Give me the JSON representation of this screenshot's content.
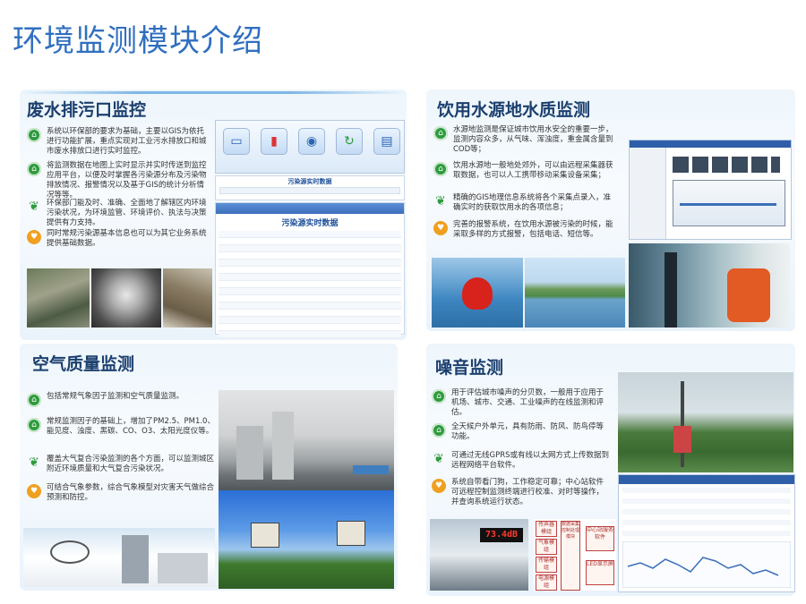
{
  "page": {
    "title": "环境监测模块介绍"
  },
  "panels": {
    "wastewater": {
      "title": "废水排污口监控",
      "bullets": [
        "系统以环保部的要求为基础，主要以GIS为依托进行功能扩展，重点实现对工业污水排放口和城市废水排放口进行实时监控。",
        "将监测数据在地图上实时显示并实时传送到监控应用平台，以便及时掌握各污染源分布及污染物排放情况、报警情况以及基于GIS的统计分析情况等等。",
        "环保部门能及时、准确、全面地了解辖区内环境污染状况，为环境监管、环境评价、执法与决策提供有力支持。",
        "同时常规污染源基本信息也可以为其它业务系统提供基础数据。"
      ],
      "table_title": "污染源实时数据",
      "search_title": "污染源实时数据"
    },
    "drinking": {
      "title": "饮用水源地水质监测",
      "bullets": [
        "水源地监测是保证城市饮用水安全的重要一步，监测内容众多，从气味、浑浊度，重金属含量到COD等；",
        "饮用水源地一般地处郊外，可以由远程采集器获取数据，也可以人工携带移动采集设备采集；",
        "精确的GIS地理信息系统将各个采集点录入，准确实时的获取饮用水的各项信息；",
        "完善的报警系统，在饮用水源被污染的时候，能采取多样的方式报警，包括电话、短信等。"
      ]
    },
    "air": {
      "title": "空气质量监测",
      "bullets": [
        "包括常规气象因子监测和空气质量监测。",
        "常规监测因子的基础上，增加了PM2.5、PM1.0、能见度、浊度、黑碳、CO、O3、太阳光度仪等。",
        "覆盖大气复合污染监测的各个方面，可以监测城区附近环境质量和大气复合污染状况。",
        "可结合气象参数，综合气象模型对灾害天气做综合预测和防控。"
      ]
    },
    "noise": {
      "title": "噪音监测",
      "bullets": [
        "用于评估城市噪声的分贝数，一般用于应用于机场、城市、交通、工业噪声的在线监测和评估。",
        "全天候户外单元，具有防雨、防风、防鸟停等功能。",
        "可通过无线GPRS或有线以太网方式上传数据到远程网络平台软件。",
        "系统自带看门狗，工作稳定可靠；中心站软件可远程控制监测终端进行校准、对时等操作，并查询系统运行状态。"
      ],
      "led_value": "73.4dB",
      "flow_labels": [
        "传声器模组",
        "气象模组",
        "传输模组",
        "电源模组",
        "数据采集控制处理模块",
        "中心站服务软件",
        "LED显示屏"
      ]
    }
  },
  "colors": {
    "title_blue": "#2f6fc0",
    "panel_title": "#1b3f6e",
    "bullet_green": "#2f9b3e",
    "bullet_orange": "#f0a020"
  }
}
